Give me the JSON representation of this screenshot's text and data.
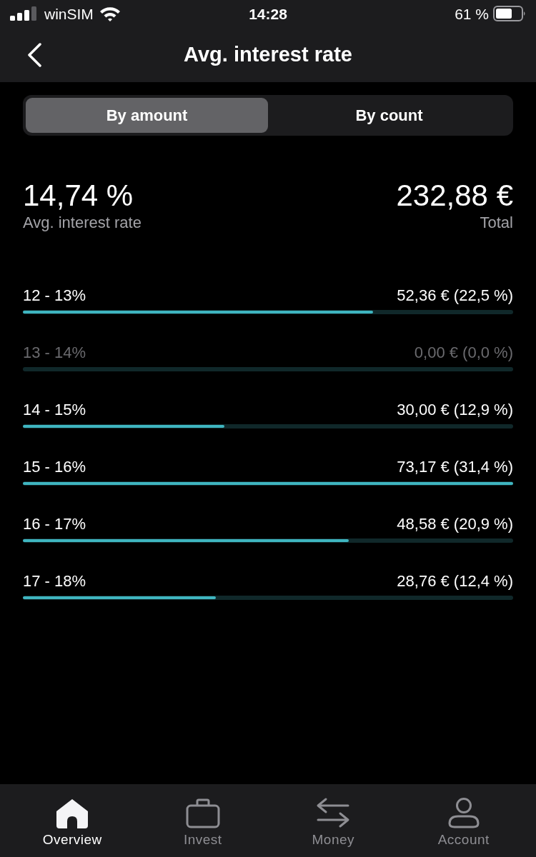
{
  "status_bar": {
    "carrier": "winSIM",
    "time": "14:28",
    "battery": "61 %"
  },
  "nav": {
    "title": "Avg. interest rate"
  },
  "segments": [
    {
      "label": "By amount",
      "selected": true
    },
    {
      "label": "By count",
      "selected": false
    }
  ],
  "summary": {
    "rate": {
      "value": "14,74 %",
      "label": "Avg. interest rate"
    },
    "total": {
      "value": "232,88 €",
      "label": "Total"
    }
  },
  "buckets": [
    {
      "range": "12 - 13%",
      "amount": "52,36 € (22,5 %)",
      "level": 0.714,
      "dimmed": false
    },
    {
      "range": "13 - 14%",
      "amount": "0,00 € (0,0 %)",
      "level": 0,
      "dimmed": true
    },
    {
      "range": "14 - 15%",
      "amount": "30,00 € (12,9 %)",
      "level": 0.411,
      "dimmed": false
    },
    {
      "range": "15 - 16%",
      "amount": "73,17 € (31,4 %)",
      "level": 1,
      "dimmed": false
    },
    {
      "range": "16 - 17%",
      "amount": "48,58 € (20,9 %)",
      "level": 0.665,
      "dimmed": false
    },
    {
      "range": "17 - 18%",
      "amount": "28,76 € (12,4 %)",
      "level": 0.394,
      "dimmed": false
    }
  ],
  "tab_bar": [
    {
      "label": "Overview",
      "selected": true
    },
    {
      "label": "Invest",
      "selected": false
    },
    {
      "label": "Money",
      "selected": false
    },
    {
      "label": "Account",
      "selected": false
    }
  ]
}
